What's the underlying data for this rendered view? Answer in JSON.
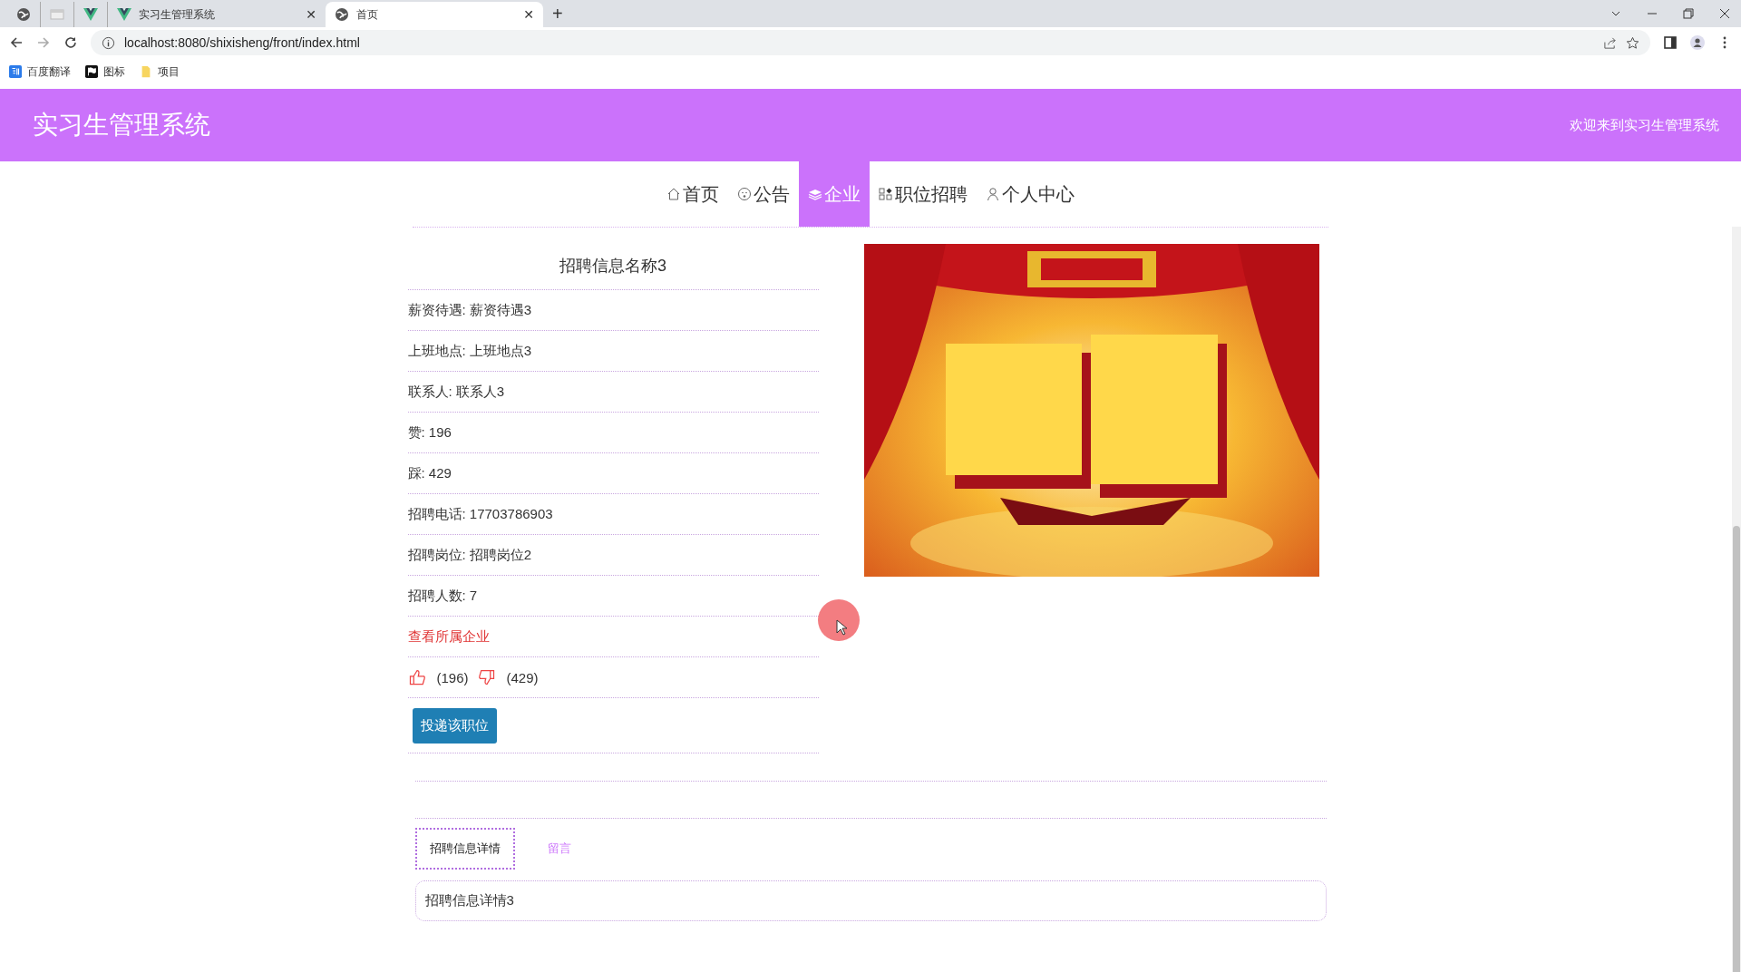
{
  "browser": {
    "tabs": [
      {
        "selected": false
      },
      {
        "selected": false
      },
      {
        "selected": false
      },
      {
        "title": "实习生管理系统",
        "close": "✕",
        "selected": false
      },
      {
        "title": "首页",
        "close": "✕",
        "selected": true
      }
    ],
    "new_tab": "+",
    "url": "localhost:8080/shixisheng/front/index.html",
    "bookmarks": [
      {
        "label": "百度翻译"
      },
      {
        "label": "图标"
      },
      {
        "label": "项目"
      }
    ]
  },
  "header": {
    "title": "实习生管理系统",
    "welcome": "欢迎来到实习生管理系统"
  },
  "nav": [
    {
      "label": "首页",
      "selected": false
    },
    {
      "label": "公告",
      "selected": false
    },
    {
      "label": "企业",
      "selected": true
    },
    {
      "label": "职位招聘",
      "selected": false
    },
    {
      "label": "个人中心",
      "selected": false
    }
  ],
  "detail": {
    "title": "招聘信息名称3",
    "fields": [
      "薪资待遇: 薪资待遇3",
      "上班地点: 上班地点3",
      "联系人: 联系人3",
      "赞: 196",
      "踩: 429",
      "招聘电话: 17703786903",
      "招聘岗位: 招聘岗位2",
      "招聘人数: 7"
    ],
    "link": "查看所属企业",
    "votes": [
      {
        "kind": "up",
        "count": "(196)"
      },
      {
        "kind": "down",
        "count": "(429)"
      }
    ],
    "button": "投递该职位"
  },
  "tabs": [
    {
      "label": "招聘信息详情",
      "selected": true
    },
    {
      "label": "留言",
      "selected": false
    }
  ],
  "content": "招聘信息详情3"
}
